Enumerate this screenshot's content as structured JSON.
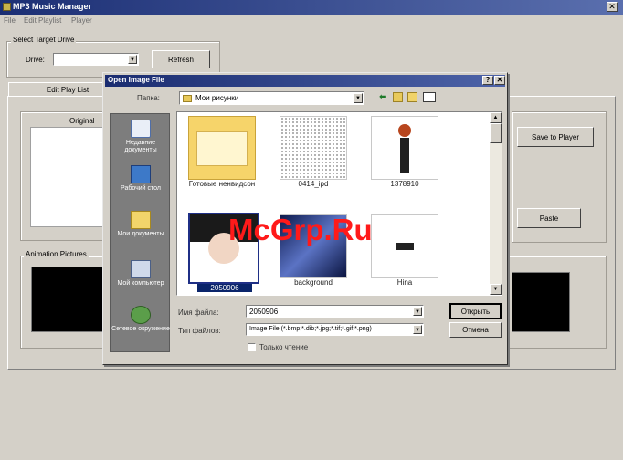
{
  "app": {
    "title": "MP3 Music Manager",
    "close_glyph": "✕",
    "menu": [
      "File",
      "Edit Playlist",
      "Player"
    ]
  },
  "target_drive": {
    "legend": "Select Target Drive",
    "drive_label": "Drive:",
    "drive_value": "",
    "refresh_label": "Refresh"
  },
  "tabs": [
    "Edit Play List"
  ],
  "main": {
    "original_label": "Original",
    "save_to_player_label": "Save to Player",
    "paste_label": "Paste",
    "animation_legend": "Animation Pictures"
  },
  "dialog": {
    "title": "Open Image File",
    "help_glyph": "?",
    "close_glyph": "✕",
    "folder_label": "Папка:",
    "folder_value": "Мои рисунки",
    "places": [
      {
        "label": "Недавние документы",
        "icon": "recent-documents-icon"
      },
      {
        "label": "Рабочий стол",
        "icon": "desktop-icon"
      },
      {
        "label": "Мои документы",
        "icon": "my-documents-icon"
      },
      {
        "label": "Мой компьютер",
        "icon": "my-computer-icon"
      },
      {
        "label": "Сетевое окружение",
        "icon": "network-places-icon"
      }
    ],
    "files": [
      {
        "name": "Готовые ненвидсон",
        "kind": "folder"
      },
      {
        "name": "0414_ipd",
        "kind": "document-image"
      },
      {
        "name": "1378910",
        "kind": "figure-image"
      },
      {
        "name": "2050906",
        "kind": "portrait-image",
        "selected": true
      },
      {
        "name": "background",
        "kind": "blue-image"
      },
      {
        "name": "Hina",
        "kind": "logo-image"
      }
    ],
    "filename_label": "Имя файла:",
    "filename_value": "2050906",
    "filetype_label": "Тип файлов:",
    "filetype_value": "Image File (*.bmp;*.dib;*.jpg;*.tif;*.gif;*.png)",
    "readonly_label": "Только чтение",
    "open_label": "Открыть",
    "cancel_label": "Отмена"
  },
  "watermark": "McGrp.Ru"
}
